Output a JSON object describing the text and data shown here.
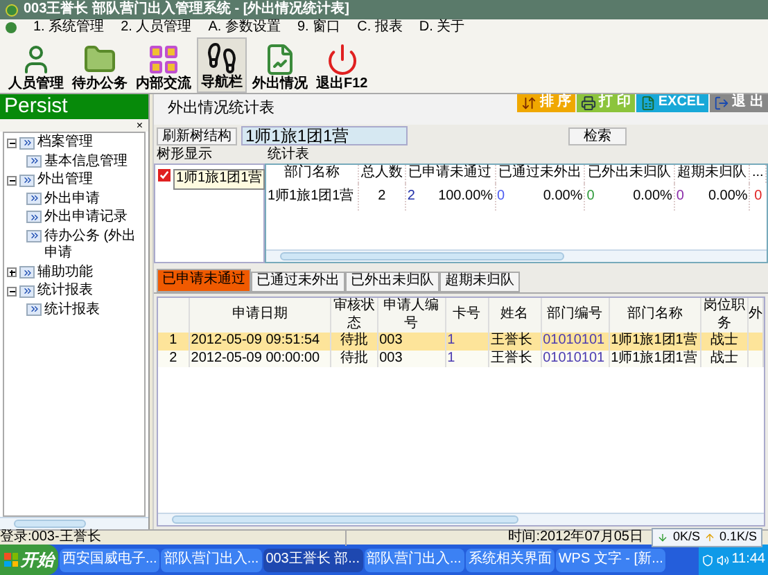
{
  "window": {
    "title": "003王誉长  部队营门出入管理系统 - [外出情况统计表]"
  },
  "menu": [
    "1. 系统管理",
    "2. 人员管理",
    "A. 参数设置",
    "9. 窗口",
    "C. 报表",
    "D. 关于"
  ],
  "toolbar": [
    {
      "label": "人员管理",
      "kind": "person",
      "selected": false
    },
    {
      "label": "待办公务",
      "kind": "folder",
      "selected": false
    },
    {
      "label": "内部交流",
      "kind": "grid",
      "selected": false
    },
    {
      "label": "导航栏",
      "kind": "footprints",
      "selected": true
    },
    {
      "label": "外出情况",
      "kind": "chart",
      "selected": false
    },
    {
      "label": "退出F12",
      "kind": "power",
      "selected": false
    }
  ],
  "side_panel": {
    "title": "Persist",
    "close": "×",
    "tree": [
      {
        "label": "档案管理",
        "expanded": true,
        "children": [
          {
            "label": "基本信息管理"
          }
        ]
      },
      {
        "label": "外出管理",
        "expanded": true,
        "children": [
          {
            "label": "外出申请"
          },
          {
            "label": "外出申请记录"
          },
          {
            "label": "待办公务 (外出申请"
          }
        ]
      },
      {
        "label": "辅助功能",
        "expanded": false
      },
      {
        "label": "统计报表",
        "expanded": true,
        "children": [
          {
            "label": "统计报表"
          }
        ]
      }
    ]
  },
  "report": {
    "title": "外出情况统计表",
    "actions": [
      {
        "label": "排 序",
        "kind": "sort"
      },
      {
        "label": "打 印",
        "kind": "print"
      },
      {
        "label": "EXCEL",
        "kind": "excel"
      },
      {
        "label": "退 出",
        "kind": "exit"
      }
    ],
    "refresh_button": "刷新树结构",
    "unit_field": {
      "value": "1师1旅1团1营"
    },
    "search_button": "检索",
    "tree_label": "树形显示",
    "table_label": "统计表",
    "tree_node": {
      "label": "1师1旅1团1营",
      "checked": true
    },
    "stats_table": {
      "columns": [
        "部门名称",
        "总人数",
        "已申请未通过",
        "已通过未外出",
        "已外出未归队",
        "超期未归队",
        "..."
      ],
      "rows": [
        {
          "name": "1师1旅1团1营",
          "total": "2",
          "groups": [
            {
              "count": "2",
              "color": "#1f2fa8",
              "percent": "100.00%"
            },
            {
              "count": "0",
              "color": "#4a5af0",
              "percent": "0.00%"
            },
            {
              "count": "0",
              "color": "#2e9a3a",
              "percent": "0.00%"
            },
            {
              "count": "0",
              "color": "#8a2aa8",
              "percent": "0.00%"
            }
          ],
          "extra": {
            "text": "0",
            "color": "#e02020"
          }
        }
      ]
    }
  },
  "tabs": [
    {
      "label": "已申请未通过",
      "selected": true
    },
    {
      "label": "已通过未外出",
      "selected": false
    },
    {
      "label": "已外出未归队",
      "selected": false
    },
    {
      "label": "超期未归队",
      "selected": false
    }
  ],
  "grid": {
    "columns": [
      "",
      "申请日期",
      "审核状态",
      "申请人编号",
      "卡号",
      "姓名",
      "部门编号",
      "部门名称",
      "岗位职务",
      "外"
    ],
    "rows": [
      {
        "selected": true,
        "cells": [
          "1",
          "2012-05-09 09:51:54",
          "待批",
          "003",
          "1",
          "王誉长",
          "01010101",
          "1师1旅1团1营",
          "战士",
          ""
        ]
      },
      {
        "selected": false,
        "cells": [
          "2",
          "2012-05-09 00:00:00",
          "待批",
          "003",
          "1",
          "王誉长",
          "01010101",
          "1师1旅1团1营",
          "战士",
          ""
        ]
      }
    ]
  },
  "status_bar": {
    "login": "登录:003-王誉长",
    "time": "时间:2012年07月05日"
  },
  "network": {
    "down": "0K/S",
    "up": "0.1K/S"
  },
  "taskbar": {
    "start": "开始",
    "items": [
      {
        "label": "西安国威电子...",
        "selected": false
      },
      {
        "label": "部队营门出入...",
        "selected": false
      },
      {
        "label": "003王誉长 部...",
        "selected": true
      },
      {
        "label": "部队营门出入...",
        "selected": false
      },
      {
        "label": "系统相关界面",
        "selected": false
      },
      {
        "label": "WPS 文字 - [新...",
        "selected": false
      }
    ],
    "clock": "11:44"
  }
}
